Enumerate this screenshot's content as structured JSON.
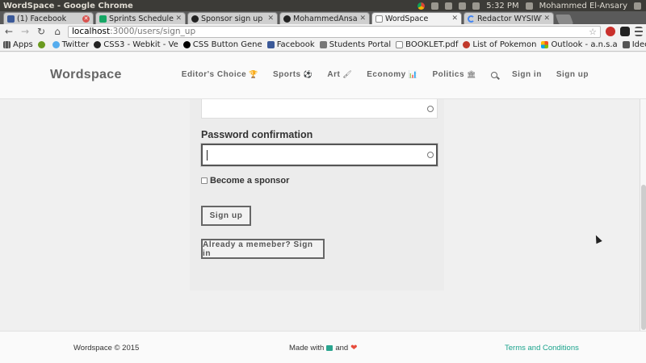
{
  "os": {
    "window_title": "WordSpace - Google Chrome",
    "time": "5:32 PM",
    "user": "Mohammed El-Ansary"
  },
  "browser": {
    "tabs": [
      {
        "label": "(1) Facebook",
        "favicon": "facebook-icon",
        "active": false
      },
      {
        "label": "Sprints Schedule - G",
        "favicon": "sheets-icon",
        "active": false
      },
      {
        "label": "Sponsor sign up by s",
        "favicon": "github-icon",
        "active": false
      },
      {
        "label": "MohammedAnsary/",
        "favicon": "github-icon",
        "active": false
      },
      {
        "label": "WordSpace",
        "favicon": "page-icon",
        "active": true
      },
      {
        "label": "Redactor WYSIWYG",
        "favicon": "loading-icon",
        "active": false
      }
    ],
    "address": {
      "host": "localhost",
      "path": ":3000/users/sign_up"
    },
    "bookmarks": [
      {
        "label": "Apps",
        "icon": "apps-icon"
      },
      {
        "label": "",
        "icon": "green-icon"
      },
      {
        "label": "Twitter",
        "icon": "twitter-icon"
      },
      {
        "label": "CSS3 - Webkit - Ve",
        "icon": "css-icon"
      },
      {
        "label": "CSS Button Gene",
        "icon": "css-button-icon"
      },
      {
        "label": "Facebook",
        "icon": "facebook-icon"
      },
      {
        "label": "Students Portal",
        "icon": "portal-icon"
      },
      {
        "label": "BOOKLET.pdf",
        "icon": "pdf-icon"
      },
      {
        "label": "List of Pokemon",
        "icon": "pokemon-icon"
      },
      {
        "label": "Outlook - a.n.s.a",
        "icon": "outlook-icon"
      },
      {
        "label": "Ideone.com | Onl",
        "icon": "ideone-icon"
      }
    ]
  },
  "site": {
    "brand": "Wordspace",
    "nav": [
      {
        "label": "Editor's Choice",
        "icon": "trophy-icon",
        "glyph": "🏆"
      },
      {
        "label": "Sports",
        "icon": "soccer-ball-icon",
        "glyph": "⚽"
      },
      {
        "label": "Art",
        "icon": "paintbrush-icon",
        "glyph": "🖌"
      },
      {
        "label": "Economy",
        "icon": "bar-chart-icon",
        "glyph": "📊"
      },
      {
        "label": "Politics",
        "icon": "institution-icon",
        "glyph": "🏛"
      }
    ],
    "sign_in": "Sign in",
    "sign_up": "Sign up"
  },
  "form": {
    "password_confirmation_label": "Password confirmation",
    "password_confirmation_value": "",
    "become_sponsor_label": "Become a sponsor",
    "become_sponsor_checked": false,
    "sign_up_button": "Sign up",
    "sign_in_button": "Already a memeber? Sign in"
  },
  "footer": {
    "copyright": "Wordspace © 2015",
    "made_with_prefix": "Made with",
    "made_with_and": "and",
    "terms": "Terms and Conditions"
  },
  "colors": {
    "accent": "#1aa38c",
    "heart": "#e74c3c"
  }
}
